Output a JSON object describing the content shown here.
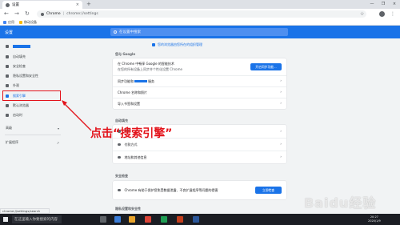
{
  "window": {
    "tab_title": "设置",
    "new_tab_symbol": "+",
    "close_symbol": "×",
    "controls": [
      "—",
      "❐",
      "×"
    ]
  },
  "toolbar": {
    "back": "←",
    "forward": "→",
    "reload": "↻",
    "site_name": "Chrome",
    "separator": "|",
    "url": "chrome://settings",
    "star": "☆",
    "menu": "⋮"
  },
  "bookmarks": [
    {
      "label": "应用",
      "icon": "apps-icon"
    },
    {
      "label": "移动设备",
      "icon": "folder-icon"
    }
  ],
  "header": {
    "title": "设置",
    "search_placeholder": "在设置中搜索"
  },
  "sidebar": {
    "items": [
      {
        "label": "",
        "icon": "person-icon",
        "redacted": true
      },
      {
        "label": "自动填充",
        "icon": "clipboard-icon"
      },
      {
        "label": "安全检查",
        "icon": "shield-icon"
      },
      {
        "label": "隐私设置和安全性",
        "icon": "shield-lock-icon"
      },
      {
        "label": "外观",
        "icon": "palette-icon"
      },
      {
        "label": "搜索引擎",
        "icon": "search-icon"
      },
      {
        "label": "默认浏览器",
        "icon": "browser-icon"
      },
      {
        "label": "启动时",
        "icon": "power-icon"
      }
    ],
    "advanced": "高级",
    "advanced_arrow": "▾",
    "extensions": "扩展程序",
    "extensions_icon": "external-link-icon"
  },
  "main": {
    "banner": "您的浏览器由您所在的组织管理",
    "google_section": "您与 Google",
    "sync_text": "在 Chrome 中畅享 Google 的智能技术",
    "sync_subtext": "在您的所有设备上同步并个性化设置 Chrome",
    "sync_button": "开启同步功能...",
    "rows": [
      {
        "label": "同步功能和",
        "suffix": "服务"
      },
      {
        "label": "Chrome 名称和照片"
      },
      {
        "label": "导入书签和设置"
      }
    ],
    "autofill_section": "自动填充",
    "autofill_rows": [
      {
        "label": "密码",
        "icon": "key-icon"
      },
      {
        "label": "付款方式",
        "icon": "card-icon"
      },
      {
        "label": "地址和其他信息",
        "icon": "pin-icon"
      }
    ],
    "safety_section": "安全检查",
    "safety_text": "Chrome 有助于保护您免受数据泄露、不良扩展程序等问题的侵害",
    "safety_button": "立即检查",
    "privacy_section": "隐私设置和安全性",
    "arrow": "›"
  },
  "annotation": "点击“搜索引擎”",
  "status_url": "chrome://settings/search",
  "taskbar": {
    "search_text": "在这里输入你要搜索的内容",
    "clock_time": "20:27",
    "clock_date": "2020/1/9"
  },
  "watermark": "Baidu经验",
  "colors": {
    "accent": "#1a73e8",
    "annotation": "#e3131b",
    "taskbar": "#1b1d23"
  }
}
